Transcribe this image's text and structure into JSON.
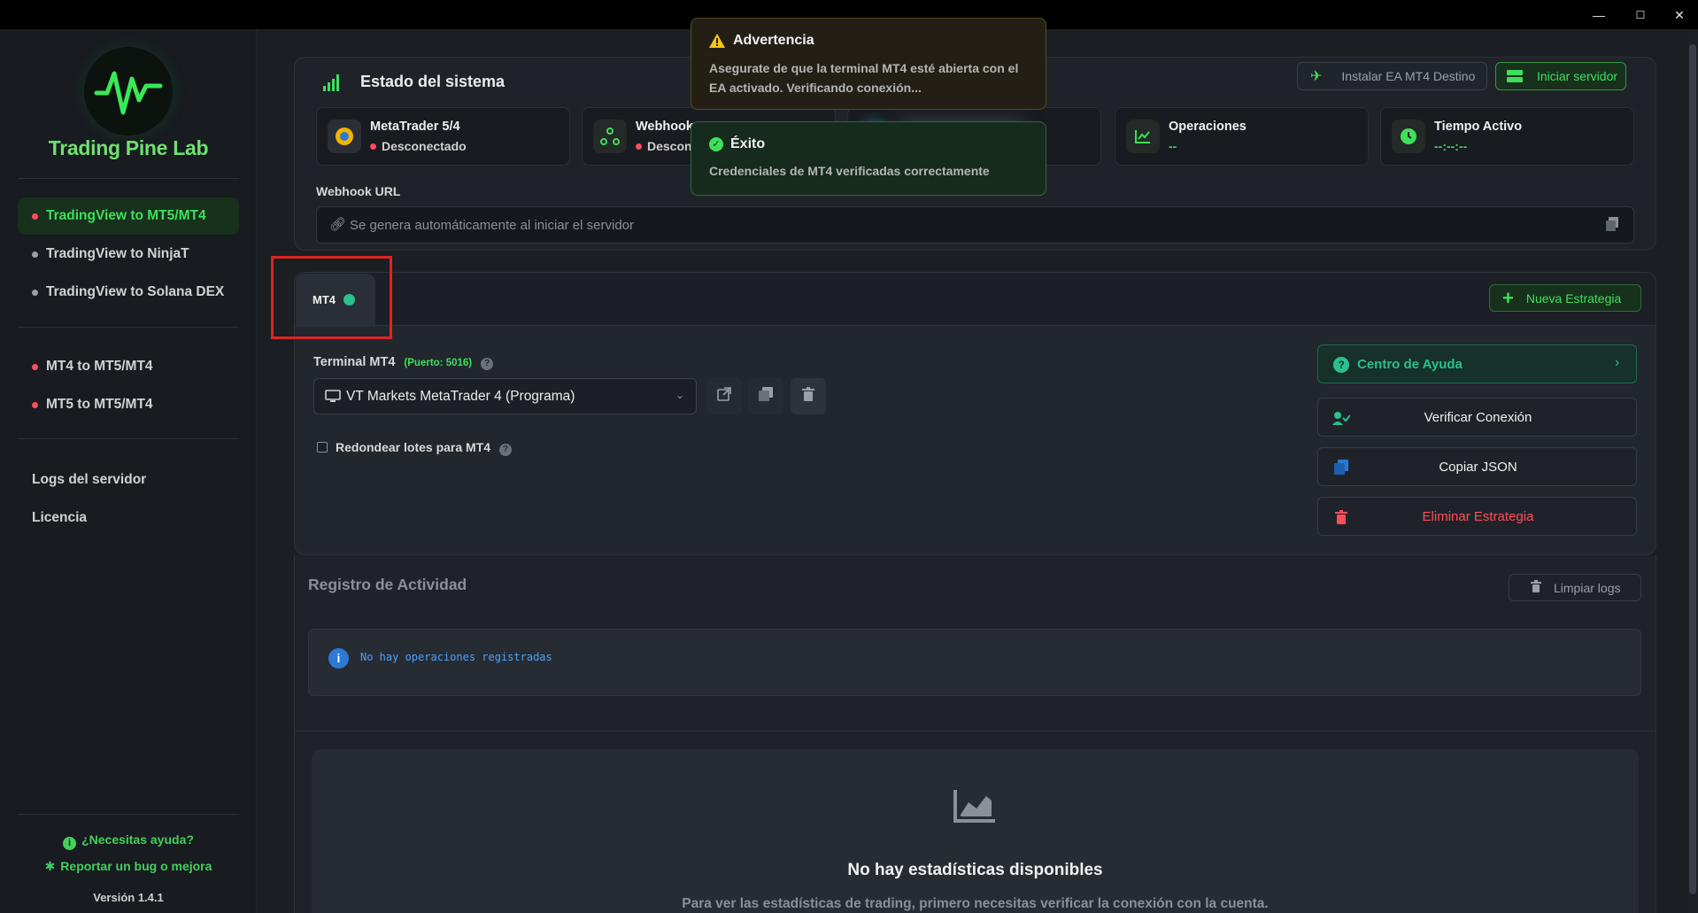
{
  "sidebar": {
    "brand": "Trading Pine Lab",
    "nav_group1": [
      {
        "label": "TradingView to MT5/MT4",
        "active": true,
        "dot": "#ff4d5a"
      },
      {
        "label": "TradingView to NinjaT",
        "active": false,
        "dot": "#9aa0a6"
      },
      {
        "label": "TradingView to Solana DEX",
        "active": false,
        "dot": "#9aa0a6"
      }
    ],
    "nav_group2": [
      {
        "label": "MT4 to MT5/MT4",
        "dot": "#ff4d5a"
      },
      {
        "label": "MT5 to MT5/MT4",
        "dot": "#ff4d5a"
      }
    ],
    "logs": "Logs del servidor",
    "license": "Licencia",
    "help": "¿Necesitas ayuda?",
    "bug": "Reportar un bug o mejora",
    "version": "Versión 1.4.1"
  },
  "status": {
    "title": "Estado del sistema",
    "install_button": "Instalar EA MT4 Destino",
    "start_button": "Iniciar servidor",
    "stats": [
      {
        "label": "MetaTrader 5/4",
        "value": "Desconectado"
      },
      {
        "label": "Webhook",
        "value": "Descon"
      },
      {
        "label": "Operaciones",
        "value": "--"
      },
      {
        "label": "Tiempo Activo",
        "value": "--:--:--"
      }
    ],
    "webhook_label": "Webhook URL",
    "webhook_placeholder": "Se genera automáticamente al iniciar el servidor"
  },
  "strategy": {
    "tab_label": "MT4",
    "new_button": "Nueva Estrategia",
    "terminal_label": "Terminal MT4",
    "port": "(Puerto: 5016)",
    "terminal_selected": "VT Markets MetaTrader 4 (Programa)",
    "round_lots": "Redondear lotes para MT4",
    "help_center": "Centro de Ayuda",
    "verify": "Verificar Conexión",
    "copy_json": "Copiar JSON",
    "delete": "Eliminar Estrategia"
  },
  "activity": {
    "title": "Registro de Actividad",
    "clear": "Limpiar logs",
    "empty": "No hay operaciones registradas"
  },
  "stats_panel": {
    "title": "No hay estadísticas disponibles",
    "subtitle": "Para ver las estadísticas de trading, primero necesitas verificar la conexión con la cuenta."
  },
  "toasts": {
    "warning_title": "Advertencia",
    "warning_body": "Asegurate de que la terminal MT4 esté abierta con el EA activado. Verificando conexión...",
    "success_title": "Éxito",
    "success_body": "Credenciales de MT4 verificadas correctamente"
  },
  "colors": {
    "accent_green": "#3ee05a",
    "danger": "#ff4d5a",
    "warning": "#f5c518",
    "help_teal": "#2bc18c"
  }
}
